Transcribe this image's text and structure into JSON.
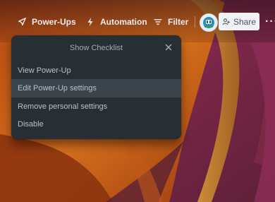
{
  "toolbar": {
    "powerups_label": "Power-Ups",
    "automation_label": "Automation",
    "filter_label": "Filter",
    "share_label": "Share",
    "more_label": "···"
  },
  "popover": {
    "title": "Show Checklist",
    "items": [
      {
        "label": "View Power-Up"
      },
      {
        "label": "Edit Power-Up settings"
      },
      {
        "label": "Remove personal settings"
      },
      {
        "label": "Disable"
      }
    ]
  },
  "colors": {
    "popover_bg": "#282e33",
    "popover_text": "#b6c2cf",
    "hover_bg": "#3b434b",
    "share_bg": "#f1f2f4"
  },
  "icons": [
    "rocket-icon",
    "bolt-icon",
    "filter-icon",
    "avatar",
    "add-person-icon",
    "close-icon"
  ]
}
